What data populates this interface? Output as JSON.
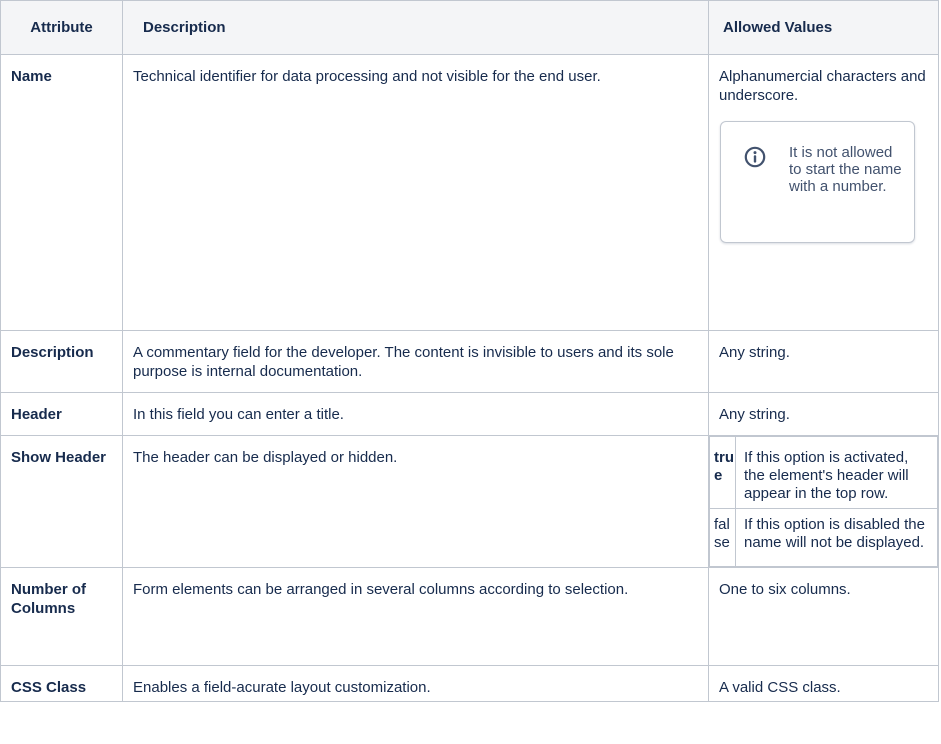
{
  "table": {
    "headers": {
      "attribute": "Attribute",
      "description": "Description",
      "allowed": "Allowed Values"
    },
    "rows": [
      {
        "attribute": "Name",
        "description": "Technical identifier for data processing and not visible for the end user.",
        "allowed": "Alphanumercial characters and underscore.",
        "info_note": "It is not allowed to start the name with a number."
      },
      {
        "attribute": "Description",
        "description": "A commentary field for the developer. The content is invisible to users and its sole purpose is internal documentation.",
        "allowed": "Any string."
      },
      {
        "attribute": "Header",
        "description": "In this field you can enter a title.",
        "allowed": "Any string."
      },
      {
        "attribute": "Show Header",
        "description": "The header can be displayed or hidden.",
        "options": [
          {
            "value": "true",
            "text": "If this option is activated, the element's header will appear in the top row."
          },
          {
            "value": "false",
            "text": "If this option is disabled the name will not be displayed."
          }
        ]
      },
      {
        "attribute": "Number of Columns",
        "description": "Form elements can be arranged in several columns according to selection.",
        "allowed": "One to six columns."
      },
      {
        "attribute": "CSS Class",
        "description": "Enables a field-acurate layout customization.",
        "allowed": "A valid CSS class."
      }
    ]
  },
  "icons": {
    "info": "info-icon"
  },
  "colors": {
    "border": "#c1c7d0",
    "header_bg": "#f4f5f7",
    "text": "#172b4d",
    "note_text": "#42526e"
  }
}
